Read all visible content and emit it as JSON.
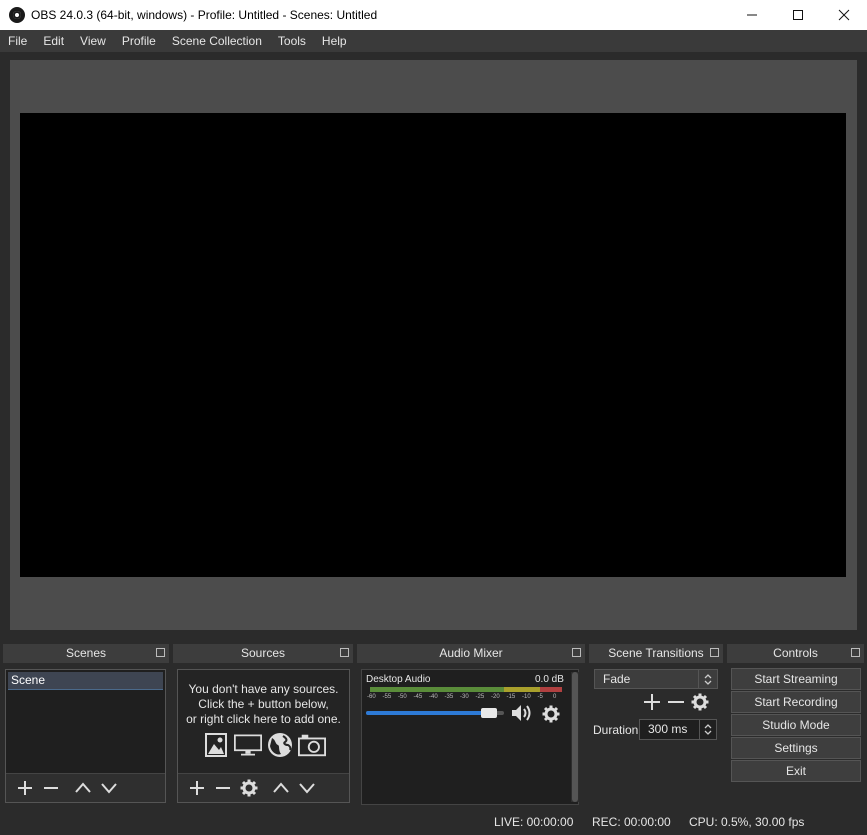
{
  "window": {
    "title": "OBS 24.0.3 (64-bit, windows) - Profile: Untitled - Scenes: Untitled",
    "minimize_icon": "minimize-icon",
    "maximize_icon": "maximize-icon",
    "close_icon": "close-icon"
  },
  "menu": [
    "File",
    "Edit",
    "View",
    "Profile",
    "Scene Collection",
    "Tools",
    "Help"
  ],
  "docks": {
    "scenes": {
      "title": "Scenes",
      "items": [
        "Scene"
      ]
    },
    "sources": {
      "title": "Sources",
      "empty_line1": "You don't have any sources.",
      "empty_line2": "Click the + button below,",
      "empty_line3": "or right click here to add one."
    },
    "mixer": {
      "title": "Audio Mixer",
      "channel": "Desktop Audio",
      "db": "0.0 dB",
      "ticks": [
        "-60",
        "-55",
        "-50",
        "-45",
        "-40",
        "-35",
        "-30",
        "-25",
        "-20",
        "-15",
        "-10",
        "-5",
        "0"
      ],
      "volume_level": 0.95
    },
    "transitions": {
      "title": "Scene Transitions",
      "selected": "Fade",
      "duration_label": "Duration",
      "duration_value": "300 ms"
    },
    "controls": {
      "title": "Controls",
      "buttons": [
        "Start Streaming",
        "Start Recording",
        "Studio Mode",
        "Settings",
        "Exit"
      ]
    }
  },
  "status": {
    "live": "LIVE: 00:00:00",
    "rec": "REC: 00:00:00",
    "cpu": "CPU: 0.5%, 30.00 fps"
  },
  "colors": {
    "accent": "#2d7ad6",
    "background": "#2b2b2b",
    "preview": "#4c4c4c"
  }
}
